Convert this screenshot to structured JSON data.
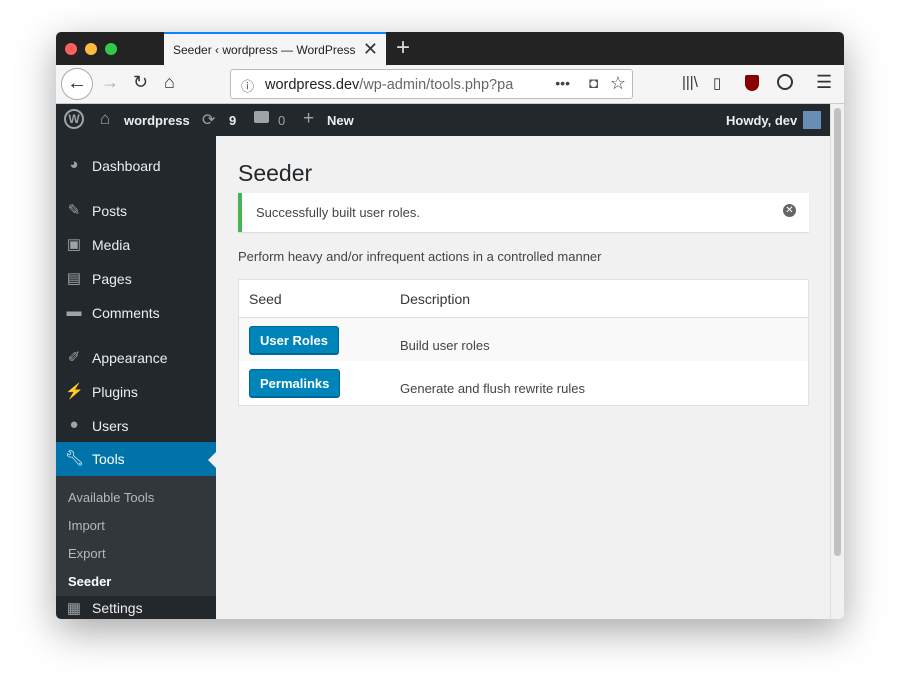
{
  "browser": {
    "tab_title": "Seeder ‹ wordpress — WordPress",
    "url_host": "wordpress.dev",
    "url_path": "/wp-admin/tools.php?pa",
    "new_tab": "+",
    "close": "✕"
  },
  "adminbar": {
    "site": "wordpress",
    "updates": "9",
    "comments": "0",
    "new": "New",
    "howdy": "Howdy, dev"
  },
  "menu": [
    {
      "label": "Dashboard",
      "icon": "dashboard-icon"
    },
    {
      "label": "Posts",
      "icon": "pin-icon"
    },
    {
      "label": "Media",
      "icon": "media-icon"
    },
    {
      "label": "Pages",
      "icon": "pages-icon"
    },
    {
      "label": "Comments",
      "icon": "comment-icon"
    },
    {
      "label": "Appearance",
      "icon": "brush-icon"
    },
    {
      "label": "Plugins",
      "icon": "plug-icon"
    },
    {
      "label": "Users",
      "icon": "user-icon"
    },
    {
      "label": "Tools",
      "icon": "wrench-icon"
    },
    {
      "label": "Settings",
      "icon": "settings-icon"
    }
  ],
  "submenu": [
    "Available Tools",
    "Import",
    "Export",
    "Seeder"
  ],
  "page": {
    "title": "Seeder",
    "notice": "Successfully built user roles.",
    "description": "Perform heavy and/or infrequent actions in a controlled manner"
  },
  "table": {
    "headers": [
      "Seed",
      "Description"
    ],
    "rows": [
      {
        "button": "User Roles",
        "desc": "Build user roles"
      },
      {
        "button": "Permalinks",
        "desc": "Generate and flush rewrite rules"
      }
    ]
  },
  "colors": {
    "accent": "#0073aa",
    "button": "#0085ba",
    "success": "#46b450",
    "sidebar": "#23282d"
  }
}
